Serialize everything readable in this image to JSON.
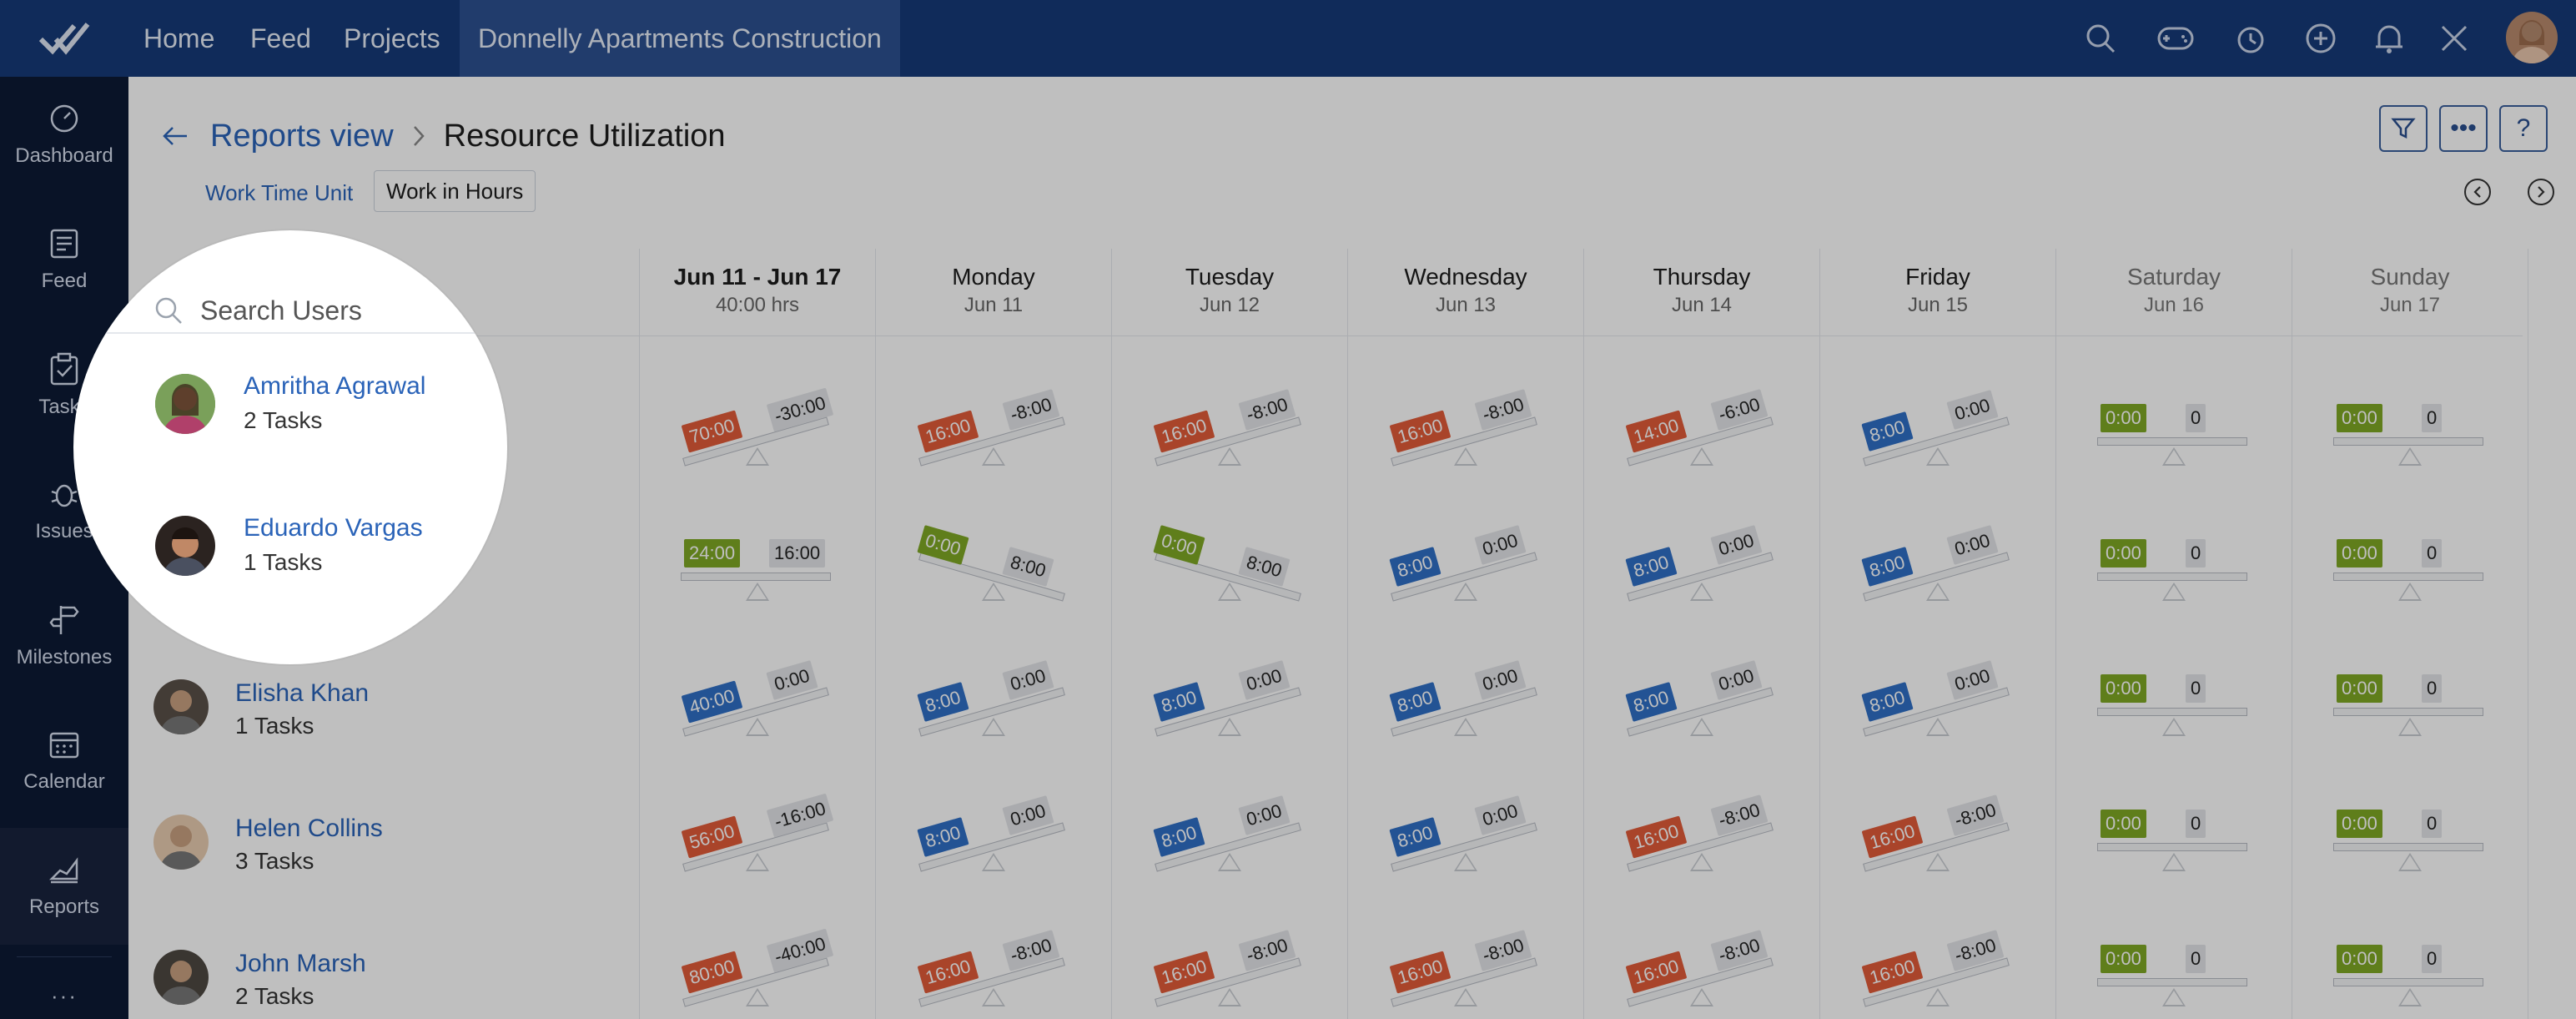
{
  "topbar": {
    "nav": [
      {
        "label": "Home"
      },
      {
        "label": "Feed"
      },
      {
        "label": "Projects"
      }
    ],
    "project": "Donnelly Apartments Construction",
    "icons": [
      "search-icon",
      "gamepad-icon",
      "timer-icon",
      "add-icon",
      "bell-icon",
      "tools-icon"
    ]
  },
  "sidebar": {
    "items": [
      {
        "label": "Dashboard",
        "icon": "gauge-icon"
      },
      {
        "label": "Feed",
        "icon": "feed-icon"
      },
      {
        "label": "Tasks",
        "icon": "clipboard-icon"
      },
      {
        "label": "Issues",
        "icon": "bug-icon"
      },
      {
        "label": "Milestones",
        "icon": "signpost-icon"
      },
      {
        "label": "Calendar",
        "icon": "calendar-icon"
      },
      {
        "label": "Reports",
        "icon": "chart-icon"
      }
    ],
    "more": "···"
  },
  "main": {
    "breadcrumb": {
      "parent": "Reports view",
      "current": "Resource Utilization"
    },
    "work_time_unit_label": "Work Time Unit",
    "work_time_unit_value": "Work in Hours",
    "toolbar": {
      "more": "•••",
      "help": "?"
    },
    "columns": [
      {
        "day": "Jun 11 - Jun 17",
        "date": "40:00 hrs"
      },
      {
        "day": "Monday",
        "date": "Jun 11"
      },
      {
        "day": "Tuesday",
        "date": "Jun 12"
      },
      {
        "day": "Wednesday",
        "date": "Jun 13"
      },
      {
        "day": "Thursday",
        "date": "Jun 14"
      },
      {
        "day": "Friday",
        "date": "Jun 15"
      },
      {
        "day": "Saturday",
        "date": "Jun 16"
      },
      {
        "day": "Sunday",
        "date": "Jun 17"
      }
    ],
    "search_placeholder": "Search Users",
    "users": [
      {
        "name": "Amritha Agrawal",
        "tasks": "2 Tasks",
        "cells": [
          [
            "70:00",
            "-30:00",
            "red",
            "left"
          ],
          [
            "16:00",
            "-8:00",
            "red",
            "left"
          ],
          [
            "16:00",
            "-8:00",
            "red",
            "left"
          ],
          [
            "16:00",
            "-8:00",
            "red",
            "left"
          ],
          [
            "14:00",
            "-6:00",
            "red",
            "left"
          ],
          [
            "8:00",
            "0:00",
            "blue",
            "left"
          ],
          [
            "0:00",
            "0",
            "green",
            "flat"
          ],
          [
            "0:00",
            "0",
            "green",
            "flat"
          ]
        ]
      },
      {
        "name": "Eduardo Vargas",
        "tasks": "1 Tasks",
        "cells": [
          [
            "24:00",
            "16:00",
            "green",
            "flat"
          ],
          [
            "0:00",
            "8:00",
            "green",
            "right"
          ],
          [
            "0:00",
            "8:00",
            "green",
            "right"
          ],
          [
            "8:00",
            "0:00",
            "blue",
            "left"
          ],
          [
            "8:00",
            "0:00",
            "blue",
            "left"
          ],
          [
            "8:00",
            "0:00",
            "blue",
            "left"
          ],
          [
            "0:00",
            "0",
            "green",
            "flat"
          ],
          [
            "0:00",
            "0",
            "green",
            "flat"
          ]
        ]
      },
      {
        "name": "Elisha Khan",
        "tasks": "1 Tasks",
        "cells": [
          [
            "40:00",
            "0:00",
            "blue",
            "left"
          ],
          [
            "8:00",
            "0:00",
            "blue",
            "left"
          ],
          [
            "8:00",
            "0:00",
            "blue",
            "left"
          ],
          [
            "8:00",
            "0:00",
            "blue",
            "left"
          ],
          [
            "8:00",
            "0:00",
            "blue",
            "left"
          ],
          [
            "8:00",
            "0:00",
            "blue",
            "left"
          ],
          [
            "0:00",
            "0",
            "green",
            "flat"
          ],
          [
            "0:00",
            "0",
            "green",
            "flat"
          ]
        ]
      },
      {
        "name": "Helen Collins",
        "tasks": "3 Tasks",
        "cells": [
          [
            "56:00",
            "-16:00",
            "red",
            "left"
          ],
          [
            "8:00",
            "0:00",
            "blue",
            "left"
          ],
          [
            "8:00",
            "0:00",
            "blue",
            "left"
          ],
          [
            "8:00",
            "0:00",
            "blue",
            "left"
          ],
          [
            "16:00",
            "-8:00",
            "red",
            "left"
          ],
          [
            "16:00",
            "-8:00",
            "red",
            "left"
          ],
          [
            "0:00",
            "0",
            "green",
            "flat"
          ],
          [
            "0:00",
            "0",
            "green",
            "flat"
          ]
        ]
      },
      {
        "name": "John Marsh",
        "tasks": "2 Tasks",
        "cells": [
          [
            "80:00",
            "-40:00",
            "red",
            "left"
          ],
          [
            "16:00",
            "-8:00",
            "red",
            "left"
          ],
          [
            "16:00",
            "-8:00",
            "red",
            "left"
          ],
          [
            "16:00",
            "-8:00",
            "red",
            "left"
          ],
          [
            "16:00",
            "-8:00",
            "red",
            "left"
          ],
          [
            "16:00",
            "-8:00",
            "red",
            "left"
          ],
          [
            "0:00",
            "0",
            "green",
            "flat"
          ],
          [
            "0:00",
            "0",
            "green",
            "flat"
          ]
        ]
      }
    ]
  },
  "colors": {
    "red": "#e25b38",
    "blue": "#2f6fc6",
    "green": "#7fa825",
    "topbar": "#163a78",
    "sidebar": "#0c1a34"
  }
}
